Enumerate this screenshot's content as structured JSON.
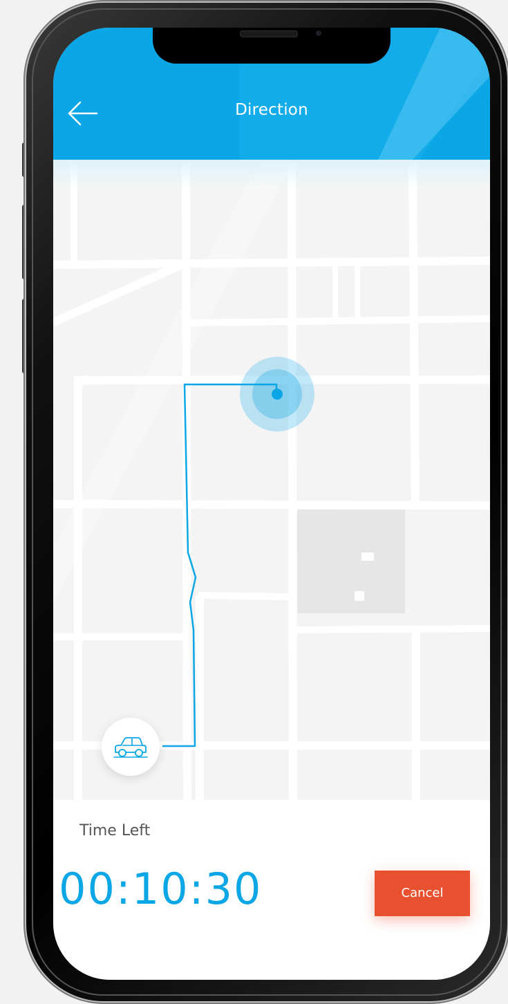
{
  "header": {
    "title": "Direction",
    "back_icon": "arrow-left-icon"
  },
  "map": {
    "destination_icon": "location-pulse-icon",
    "vehicle_icon": "car-icon",
    "route_color": "#0aa6e6",
    "block_color": "#f4f4f4",
    "road_color": "#ffffff",
    "building_color": "#e6e6e6"
  },
  "trip": {
    "time_left_label": "Time Left",
    "countdown": "00:10:30",
    "cancel_label": "Cancel"
  },
  "colors": {
    "accent": "#0aa6e6",
    "cancel": "#e8512f",
    "background": "#f2f2f2"
  }
}
